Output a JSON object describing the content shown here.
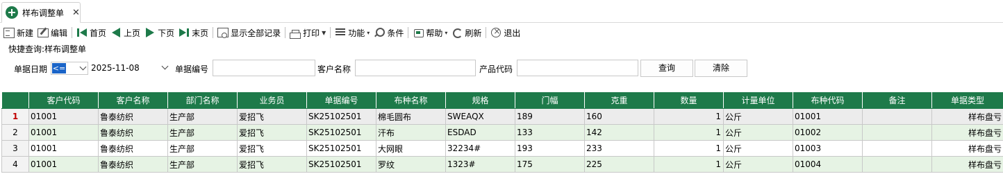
{
  "tab": {
    "title": "样布调整单",
    "close": "✕"
  },
  "toolbar": {
    "new": "新建",
    "edit": "编辑",
    "first": "首页",
    "prev": "上页",
    "next": "下页",
    "last": "末页",
    "show_all": "显示全部记录",
    "print": "打印",
    "function": "功能",
    "condition": "条件",
    "help": "帮助",
    "refresh": "刷新",
    "exit": "退出"
  },
  "quick_search": {
    "title": "快捷查询:样布调整单",
    "date_label": "单据日期",
    "operator": "<=",
    "date_value": "2025-11-08",
    "doc_no_label": "单据编号",
    "doc_no_value": "",
    "customer_label": "客户名称",
    "customer_value": "",
    "product_label": "产品代码",
    "product_value": "",
    "query_button": "查询",
    "clear_button": "清除"
  },
  "table": {
    "columns": [
      "客户代码",
      "客户名称",
      "部门名称",
      "业务员",
      "单据编号",
      "布种名称",
      "规格",
      "门幅",
      "克重",
      "数量",
      "计量单位",
      "布种代码",
      "备注",
      "单据类型"
    ],
    "rows": [
      {
        "n": "1",
        "cells": [
          "01001",
          "鲁泰纺织",
          "生产部",
          "爱招飞",
          "SK25102501",
          "棉毛圆布",
          "SWEAQX",
          "189",
          "160",
          "1",
          "公斤",
          "01001",
          "",
          "样布盘亏"
        ]
      },
      {
        "n": "2",
        "cells": [
          "01001",
          "鲁泰纺织",
          "生产部",
          "爱招飞",
          "SK25102501",
          "汗布",
          "ESDAD",
          "133",
          "142",
          "1",
          "公斤",
          "01002",
          "",
          "样布盘亏"
        ]
      },
      {
        "n": "3",
        "cells": [
          "01001",
          "鲁泰纺织",
          "生产部",
          "爱招飞",
          "SK25102501",
          "大网眼",
          "32234#",
          "193",
          "233",
          "1",
          "公斤",
          "01003",
          "",
          "样布盘亏"
        ]
      },
      {
        "n": "4",
        "cells": [
          "01001",
          "鲁泰纺织",
          "生产部",
          "爱招飞",
          "SK25102501",
          "罗纹",
          "1323#",
          "175",
          "225",
          "1",
          "公斤",
          "01004",
          "",
          "样布盘亏"
        ]
      }
    ]
  },
  "colors": {
    "header_green": "#1e7a4a",
    "row_alt": "#e6f3e4",
    "selected_row_num": "#c00000",
    "operator_highlight": "#1a64c8"
  }
}
